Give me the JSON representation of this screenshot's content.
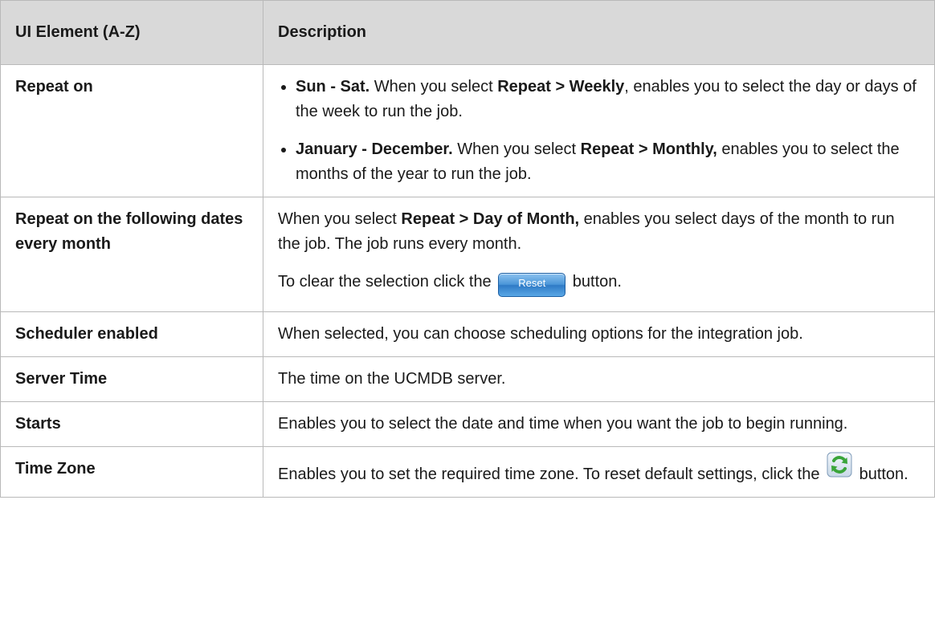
{
  "table": {
    "headers": [
      "UI Element (A-Z)",
      "Description"
    ],
    "rows": [
      {
        "name": "Repeat on",
        "bullets": [
          {
            "lead": "Sun - Sat.",
            "t1": " When you select ",
            "b1": "Repeat > Weekly",
            "t2": ", enables you to select the day or days of the week to run the job."
          },
          {
            "lead": "January - December.",
            "t1": " When you select ",
            "b1": "Repeat > Monthly,",
            "t2": " enables you to select the months of the year to run the job."
          }
        ]
      },
      {
        "name": "Repeat on the following dates every month",
        "p1_pre": "When you select ",
        "p1_bold": "Repeat > Day of Month,",
        "p1_post": " enables you select days of the month to run the job. The job runs every month.",
        "p2_pre": "To clear the selection click the ",
        "reset_label": "Reset",
        "p2_post": " button."
      },
      {
        "name": "Scheduler enabled",
        "desc": "When selected, you can choose scheduling options for the integration job."
      },
      {
        "name": "Server Time",
        "desc": "The time on the UCMDB server."
      },
      {
        "name": "Starts",
        "desc": "Enables you to select the date and time when you want the job to begin running."
      },
      {
        "name": "Time Zone",
        "desc_pre": "Enables you to set the required time zone. To reset default settings, click the ",
        "refresh_icon": "refresh-icon",
        "desc_post": " button."
      }
    ]
  },
  "colors": {
    "header_bg": "#d9d9d9",
    "border": "#b9b9b9",
    "reset_button": "#4a95d8",
    "refresh_green": "#3aa53a"
  }
}
